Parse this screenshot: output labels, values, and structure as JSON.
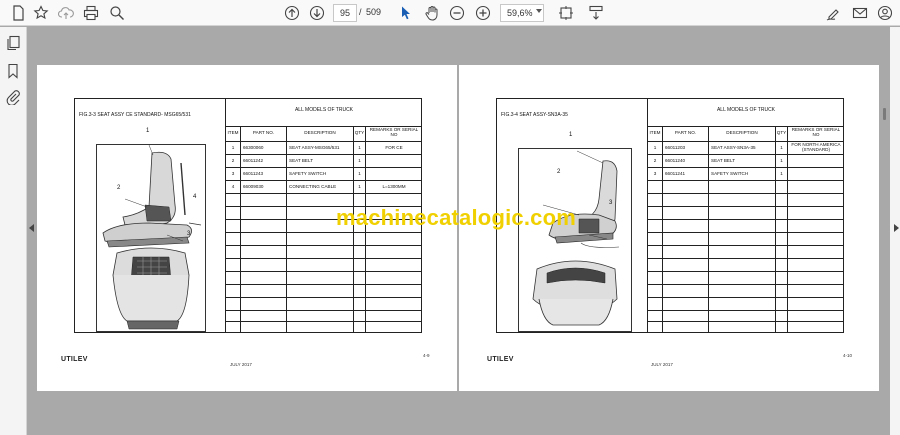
{
  "toolbar": {
    "current_page": "95",
    "page_separator": "/",
    "total_pages": "509",
    "zoom": "59,6%"
  },
  "watermark": "machinecatalogic.com",
  "left_page": {
    "fig_title": "FIG.3-3    SEAT ASSY CE STANDARD- MSG65/531",
    "models": "ALL MODELS OF TRUCK",
    "headers": {
      "item": "ITEM",
      "part": "PART NO.",
      "desc": "DESCRIPTION",
      "qty": "QTY",
      "remarks": "REMARKS OR SERIAL NO"
    },
    "rows": [
      {
        "item": "1",
        "part": "66300060",
        "desc": "SEAT ASSY-MSG65/531",
        "qty": "1",
        "remarks": "FOR CE"
      },
      {
        "item": "2",
        "part": "66011242",
        "desc": "SEAT BELT",
        "qty": "1",
        "remarks": ""
      },
      {
        "item": "3",
        "part": "66011243",
        "desc": "SAFETY SWITCH",
        "qty": "1",
        "remarks": ""
      },
      {
        "item": "4",
        "part": "66009030",
        "desc": "CONNECTING CABLE",
        "qty": "1",
        "remarks": "L=1300MM"
      }
    ],
    "callouts": [
      "1",
      "2",
      "3",
      "4"
    ],
    "logo": "UTILEV",
    "date": "JULY 2017",
    "page_number": "4-9"
  },
  "right_page": {
    "fig_title": "FIG.3-4    SEAT ASSY-SN3A-35",
    "models": "ALL MODELS OF TRUCK",
    "headers": {
      "item": "ITEM",
      "part": "PART NO.",
      "desc": "DESCRIPTION",
      "qty": "QTY",
      "remarks": "REMARKS OR SERIAL NO"
    },
    "rows": [
      {
        "item": "1",
        "part": "66011203",
        "desc": "SEAT ASSY-SN3A-35",
        "qty": "1",
        "remarks": "FOR NORTH AMERICA (STANDARD)"
      },
      {
        "item": "2",
        "part": "66011240",
        "desc": "SEAT BELT",
        "qty": "1",
        "remarks": ""
      },
      {
        "item": "3",
        "part": "66011241",
        "desc": "SAFETY SWITCH",
        "qty": "1",
        "remarks": ""
      }
    ],
    "callouts": [
      "1",
      "2",
      "3"
    ],
    "logo": "UTILEV",
    "date": "JULY 2017",
    "page_number": "4-10"
  }
}
